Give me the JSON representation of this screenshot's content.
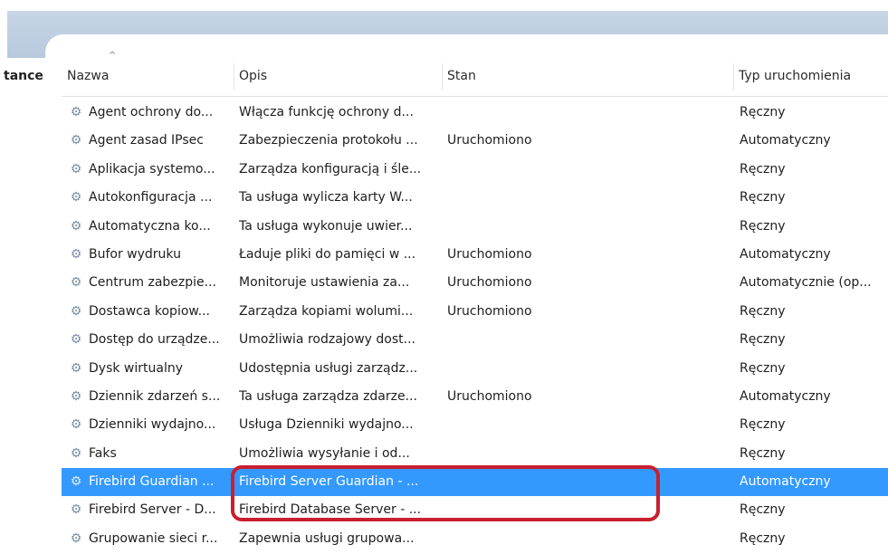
{
  "left_label": "tance",
  "columns": [
    "Nazwa",
    "Opis",
    "Stan",
    "Typ uruchomienia"
  ],
  "sort_arrow": "^",
  "icon": "service-gear-icon",
  "colors": {
    "selection": "#3399ff",
    "highlight_border": "#c8202e",
    "band": "#c7d6e6"
  },
  "rows": [
    {
      "name": "Agent ochrony do...",
      "desc": "Włącza funkcję ochrony d...",
      "state": "",
      "start": "Ręczny"
    },
    {
      "name": "Agent zasad IPsec",
      "desc": "Zabezpieczenia protokołu ...",
      "state": "Uruchomiono",
      "start": "Automatyczny"
    },
    {
      "name": "Aplikacja systemo...",
      "desc": "Zarządza konfiguracją i śle...",
      "state": "",
      "start": "Ręczny"
    },
    {
      "name": "Autokonfiguracja ...",
      "desc": "Ta usługa wylicza karty W...",
      "state": "",
      "start": "Ręczny"
    },
    {
      "name": "Automatyczna ko...",
      "desc": "Ta usługa wykonuje uwier...",
      "state": "",
      "start": "Ręczny"
    },
    {
      "name": "Bufor wydruku",
      "desc": "Ładuje pliki do pamięci w ...",
      "state": "Uruchomiono",
      "start": "Automatyczny"
    },
    {
      "name": "Centrum zabezpie...",
      "desc": "Monitoruje ustawienia za...",
      "state": "Uruchomiono",
      "start": "Automatycznie (op..."
    },
    {
      "name": "Dostawca kopiow...",
      "desc": "Zarządza kopiami wolumi...",
      "state": "Uruchomiono",
      "start": "Ręczny"
    },
    {
      "name": "Dostęp do urządze...",
      "desc": "Umożliwia rodzajowy dost...",
      "state": "",
      "start": "Ręczny"
    },
    {
      "name": "Dysk wirtualny",
      "desc": "Udostępnia usługi zarządz...",
      "state": "",
      "start": "Ręczny"
    },
    {
      "name": "Dziennik zdarzeń s...",
      "desc": "Ta usługa zarządza zdarze...",
      "state": "Uruchomiono",
      "start": "Automatyczny"
    },
    {
      "name": "Dzienniki wydajno...",
      "desc": "Usługa Dzienniki wydajno...",
      "state": "",
      "start": "Ręczny"
    },
    {
      "name": "Faks",
      "desc": "Umożliwia wysyłanie i od...",
      "state": "",
      "start": "Ręczny"
    },
    {
      "name": "Firebird Guardian ...",
      "desc": "Firebird Server Guardian - ...",
      "state": "",
      "start": "Automatyczny",
      "selected": true
    },
    {
      "name": "Firebird Server - D...",
      "desc": "Firebird Database Server - ...",
      "state": "",
      "start": "Ręczny"
    },
    {
      "name": "Grupowanie sieci r...",
      "desc": "Zapewnia usługi grupowa...",
      "state": "",
      "start": "Ręczny"
    }
  ]
}
